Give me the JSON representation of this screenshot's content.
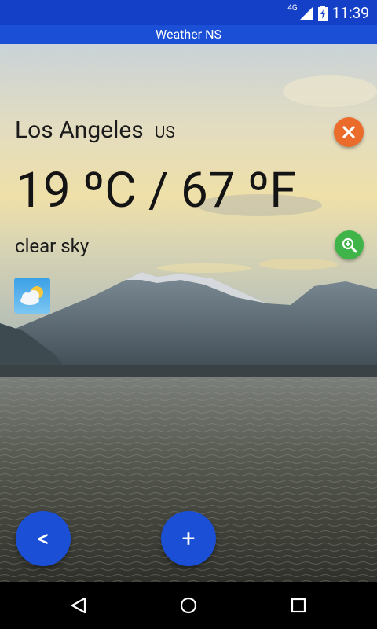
{
  "status_bar": {
    "network_label": "4G",
    "time": "11:39"
  },
  "app": {
    "title": "Weather NS"
  },
  "weather": {
    "city": "Los Angeles",
    "country": "US",
    "temperature": "19 ºC / 67 ºF",
    "description": "clear sky"
  },
  "icons": {
    "close": "close-icon",
    "zoom": "zoom-icon",
    "weather": "partly-cloudy-icon",
    "back": "chevron-left-icon",
    "add": "plus-icon"
  },
  "fab": {
    "back_label": "<",
    "add_label": "+"
  },
  "colors": {
    "status_bar": "#1440c8",
    "app_bar": "#1a4fd6",
    "fab": "#1a4fd6",
    "close_button": "#ea6b2a",
    "zoom_button": "#3fb549"
  }
}
